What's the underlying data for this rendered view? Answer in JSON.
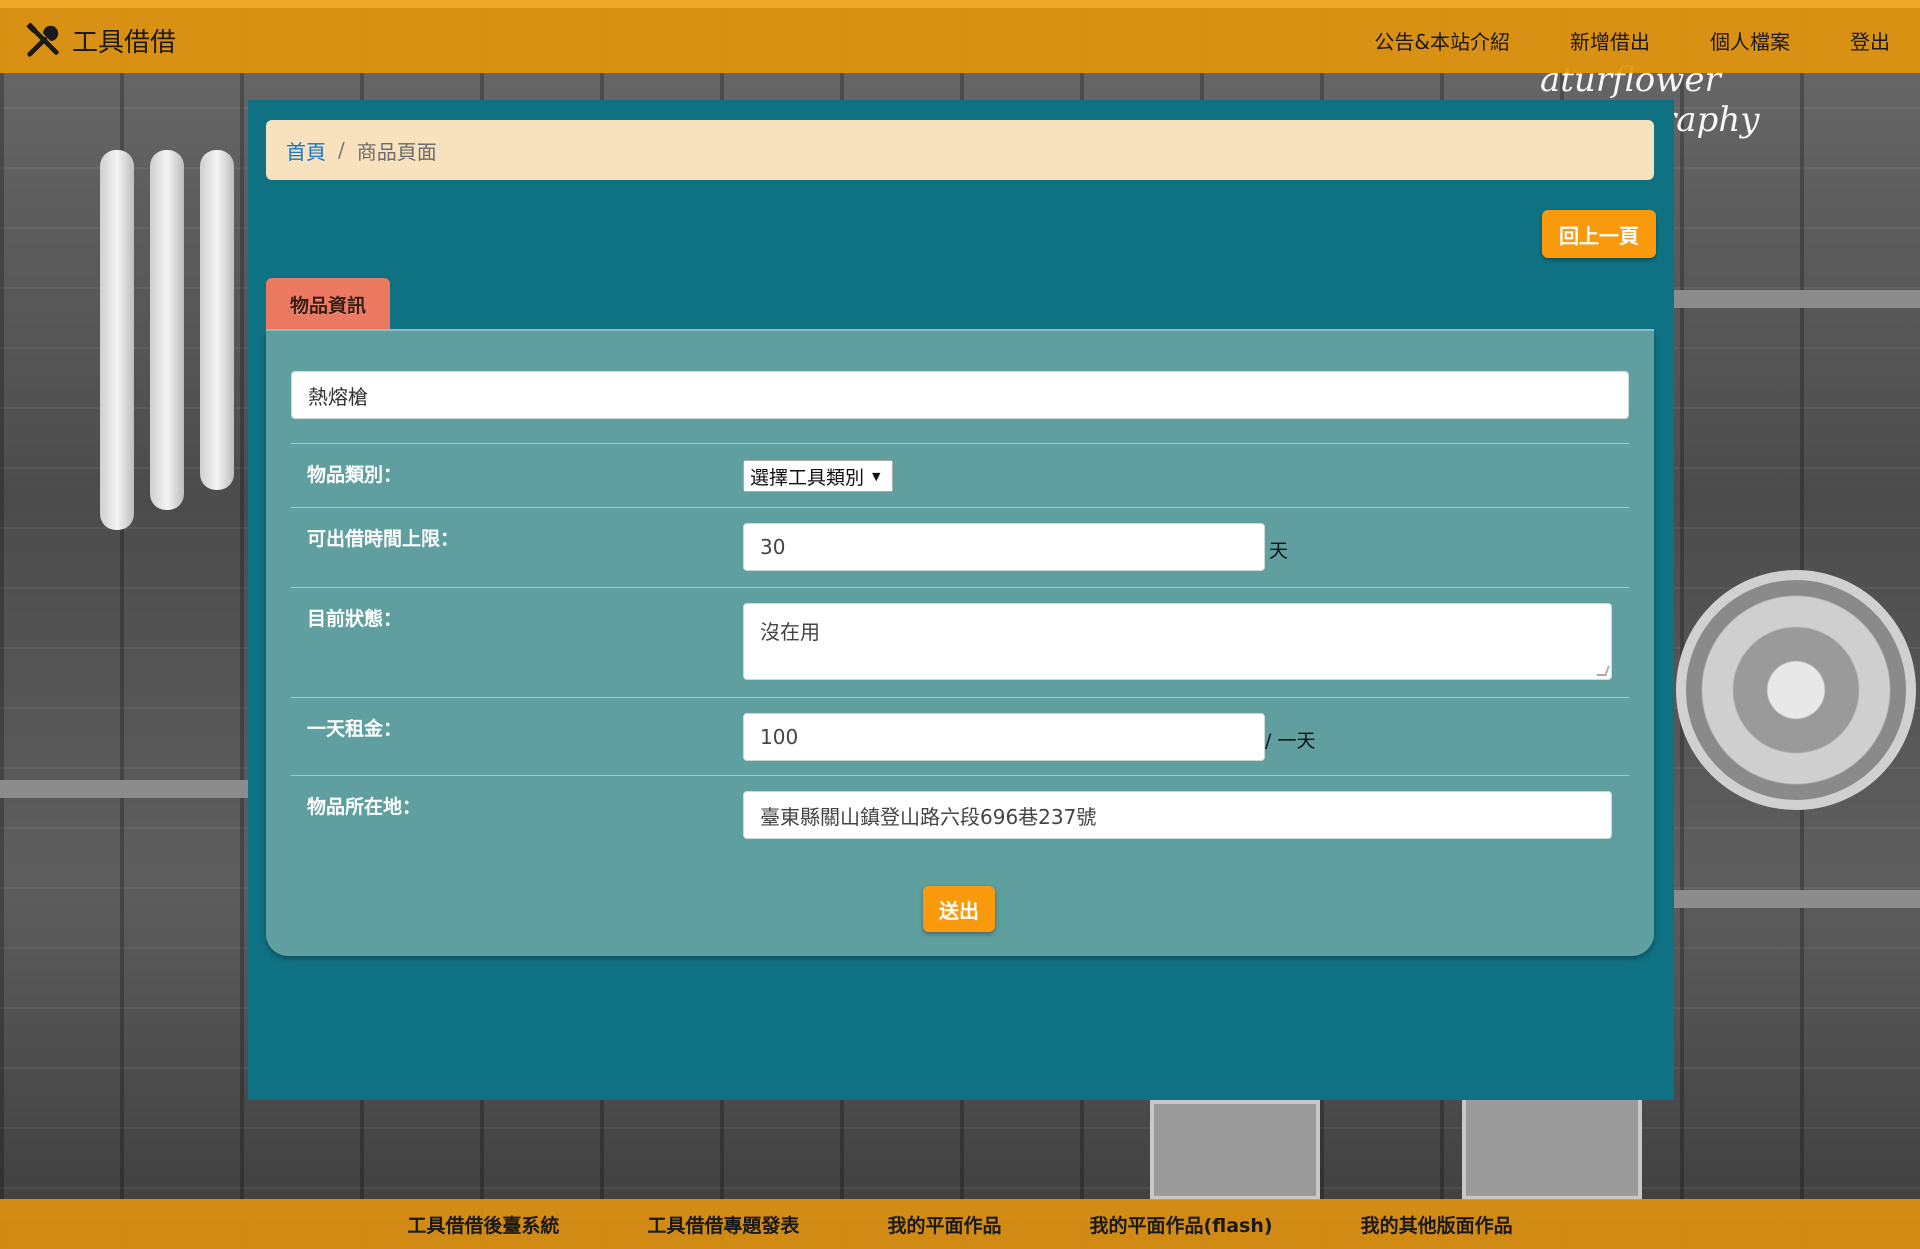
{
  "colors": {
    "topbar": "#e2940e",
    "panel": "#0f7283",
    "card": "#609f9f",
    "breadcrumb_bg": "#f7e2bd",
    "tab": "#ec7a62",
    "button": "#f99a0c",
    "link": "#1a73c9"
  },
  "topbar": {
    "brand_icon": "tools-icon",
    "brand": "工具借借",
    "nav": [
      "公告&本站介紹",
      "新增借出",
      "個人檔案",
      "登出"
    ]
  },
  "background": {
    "watermark": "aturflower photography"
  },
  "breadcrumb": {
    "home": "首頁",
    "separator": "/",
    "current": "商品頁面"
  },
  "back_button": "回上一頁",
  "tab": "物品資訊",
  "form": {
    "item_name": "熱熔槍",
    "category": {
      "label": "物品類別：",
      "selected": "選擇工具類別",
      "arrow": "▼"
    },
    "max_days": {
      "label": "可出借時間上限：",
      "value": "30",
      "unit": "天"
    },
    "status": {
      "label": "目前狀態：",
      "value": "沒在用"
    },
    "rent": {
      "label": "一天租金：",
      "value": "100",
      "unit": "/ 一天"
    },
    "location": {
      "label": "物品所在地：",
      "value": "臺東縣關山鎮登山路六段696巷237號"
    },
    "submit": "送出"
  },
  "footer": [
    "工具借借後臺系統",
    "工具借借專題發表",
    "我的平面作品",
    "我的平面作品(flash)",
    "我的其他版面作品"
  ]
}
